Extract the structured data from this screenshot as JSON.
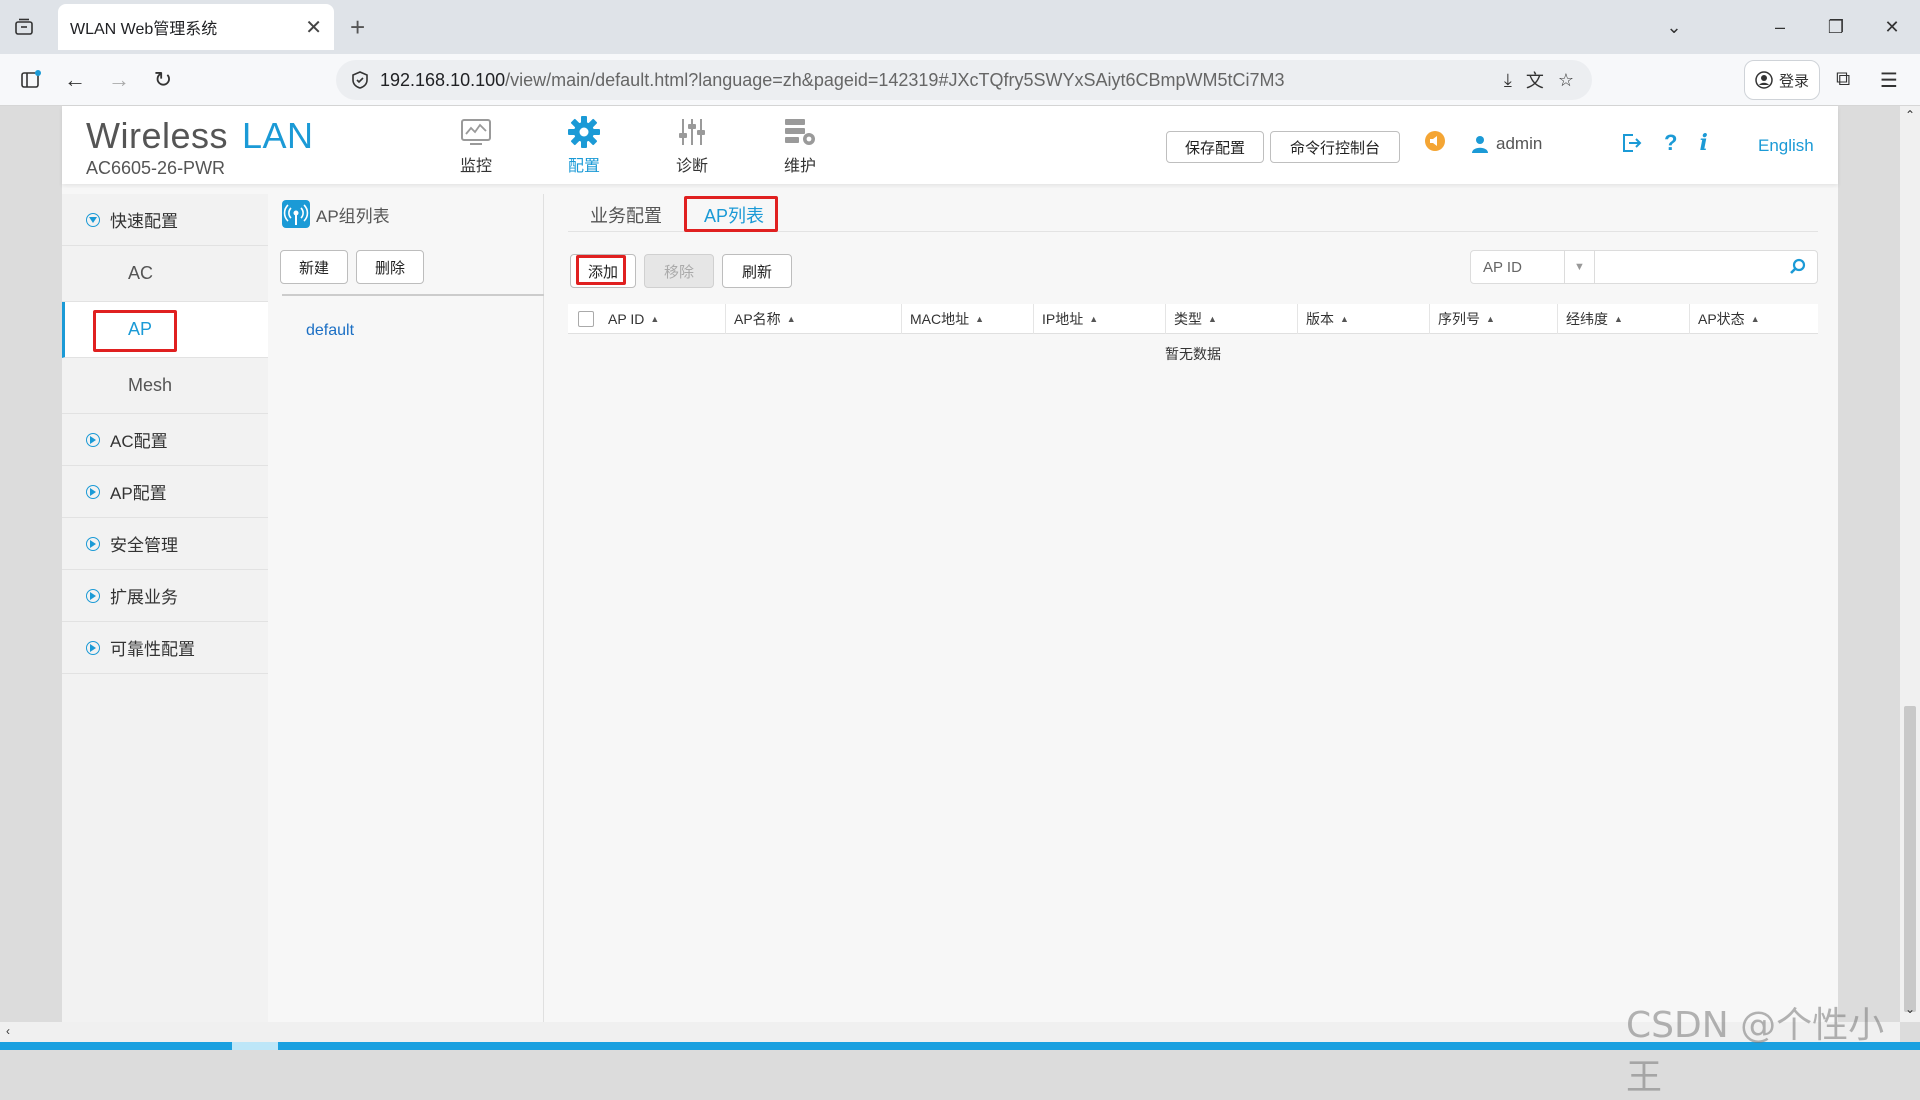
{
  "browser": {
    "tab_title": "WLAN Web管理系统",
    "url_host": "192.168.10.100",
    "url_path": "/view/main/default.html?language=zh&pageid=142319#JXcTQfry5SWYxSAiyt6CBmpWM5tCi7M3",
    "login_label": "登录"
  },
  "header": {
    "brand_word1": "Wireless",
    "brand_word2": "LAN",
    "model": "AC6605-26-PWR",
    "nav": [
      {
        "label": "监控",
        "icon": "monitor-icon"
      },
      {
        "label": "配置",
        "icon": "gear-icon"
      },
      {
        "label": "诊断",
        "icon": "sliders-icon"
      },
      {
        "label": "维护",
        "icon": "maintenance-icon"
      }
    ],
    "save_config": "保存配置",
    "cli_console": "命令行控制台",
    "user": "admin",
    "language": "English"
  },
  "sidebar": {
    "quick": "快速配置",
    "sub_items": [
      "AC",
      "AP",
      "Mesh"
    ],
    "groups": [
      "AC配置",
      "AP配置",
      "安全管理",
      "扩展业务",
      "可靠性配置"
    ]
  },
  "ap_group": {
    "title": "AP组列表",
    "new_label": "新建",
    "delete_label": "删除",
    "items": [
      "default"
    ]
  },
  "content": {
    "tabs": [
      "业务配置",
      "AP列表"
    ],
    "add_label": "添加",
    "remove_label": "移除",
    "refresh_label": "刷新",
    "filter_field": "AP ID",
    "columns": [
      "AP ID",
      "AP名称",
      "MAC地址",
      "IP地址",
      "类型",
      "版本",
      "序列号",
      "经纬度",
      "AP状态"
    ],
    "empty": "暂无数据"
  },
  "watermark": "CSDN @个性小王",
  "colors": {
    "accent": "#1b9ad6",
    "highlight": "#e02020"
  }
}
